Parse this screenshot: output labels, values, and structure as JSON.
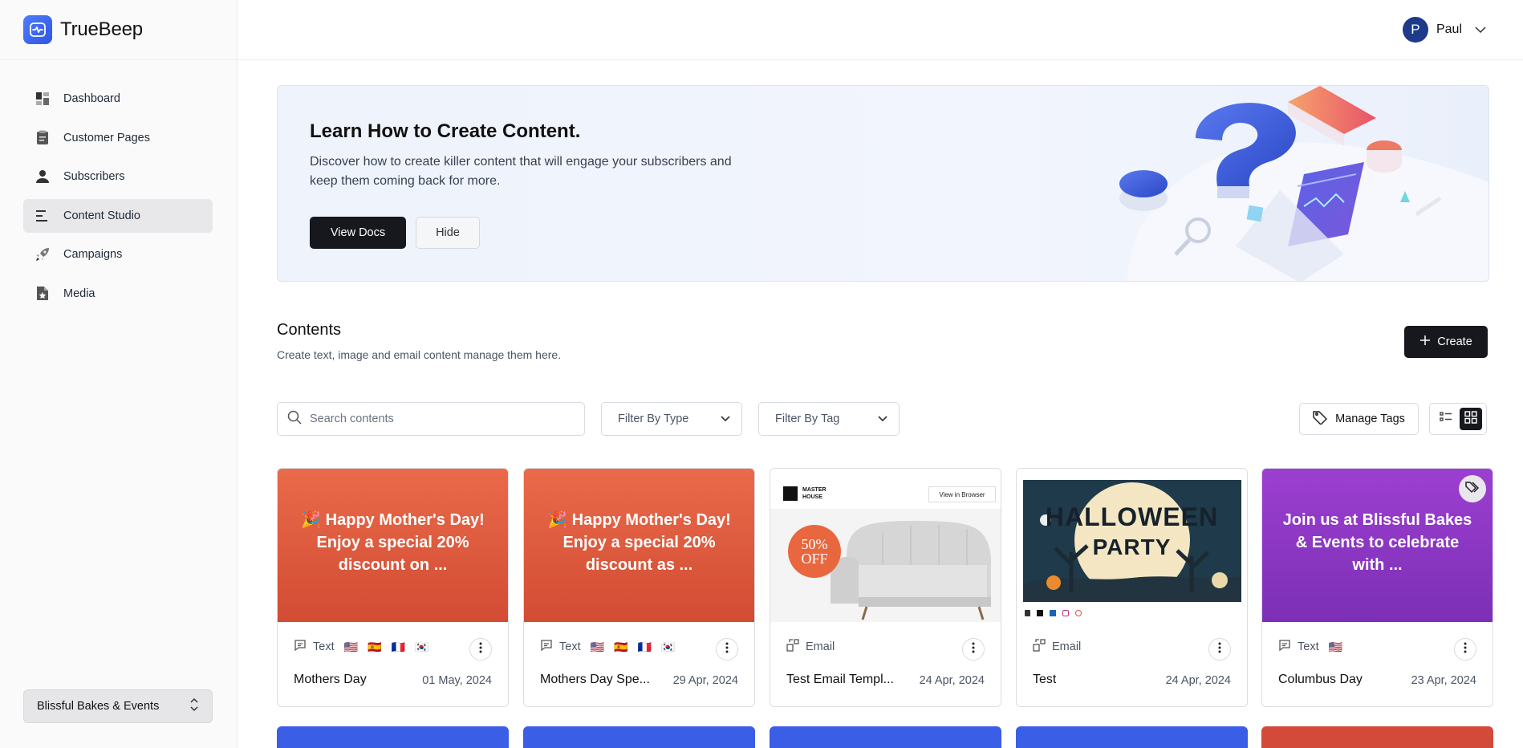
{
  "brand": {
    "name": "TrueBeep"
  },
  "sidebar": {
    "items": [
      {
        "label": "Dashboard",
        "icon": "dashboard-icon"
      },
      {
        "label": "Customer Pages",
        "icon": "clipboard-icon"
      },
      {
        "label": "Subscribers",
        "icon": "user-icon"
      },
      {
        "label": "Content Studio",
        "icon": "lines-icon",
        "active": true
      },
      {
        "label": "Campaigns",
        "icon": "rocket-icon"
      },
      {
        "label": "Media",
        "icon": "file-star-icon"
      }
    ],
    "workspace": "Blissful Bakes & Events"
  },
  "user": {
    "initial": "P",
    "name": "Paul"
  },
  "banner": {
    "title": "Learn How to Create Content.",
    "description": "Discover how to create killer content that will engage your subscribers and keep them coming back for more.",
    "primary_button": "View Docs",
    "secondary_button": "Hide"
  },
  "contents": {
    "title": "Contents",
    "subtitle": "Create text, image and email content manage them here.",
    "create_label": "Create"
  },
  "toolbar": {
    "search_placeholder": "Search contents",
    "filter_type": "Filter By Type",
    "filter_tag": "Filter By Tag",
    "manage_tags": "Manage Tags"
  },
  "cards": [
    {
      "type": "Text",
      "flags": [
        "🇺🇸",
        "🇪🇸",
        "🇫🇷",
        "🇰🇷"
      ],
      "name": "Mothers Day",
      "date": "01 May, 2024",
      "preview": "🎉 Happy Mother's Day! Enjoy a special 20% discount on ..."
    },
    {
      "type": "Text",
      "flags": [
        "🇺🇸",
        "🇪🇸",
        "🇫🇷",
        "🇰🇷"
      ],
      "name": "Mothers Day Spe...",
      "date": "29 Apr, 2024",
      "preview": "🎉 Happy Mother's Day! Enjoy a special 20% discount as ..."
    },
    {
      "type": "Email",
      "flags": [],
      "name": "Test Email Templ...",
      "date": "24 Apr, 2024",
      "preview_brand": "MASTER HOUSE",
      "preview_link": "View in Browser",
      "preview_badge": "50% OFF"
    },
    {
      "type": "Email",
      "flags": [],
      "name": "Test",
      "date": "24 Apr, 2024",
      "preview_title": "HALLOWEEN",
      "preview_sub": "PARTY"
    },
    {
      "type": "Text",
      "flags": [
        "🇺🇸"
      ],
      "name": "Columbus Day",
      "date": "23 Apr, 2024",
      "preview": "Join us at Blissful Bakes & Events to celebrate with ..."
    }
  ],
  "colors": {
    "orange": "#e3583c",
    "purple": "#8b36c4",
    "blue": "#3b5ee6",
    "red": "#d34a3a",
    "dark": "#16181d"
  }
}
